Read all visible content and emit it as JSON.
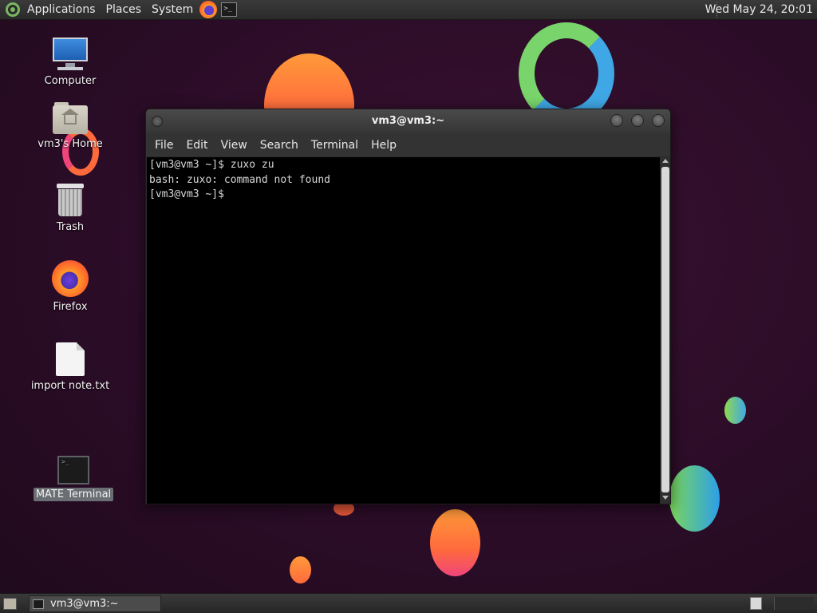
{
  "top_panel": {
    "menus": {
      "applications": "Applications",
      "places": "Places",
      "system": "System"
    },
    "launchers": [
      "firefox-icon",
      "terminal-icon"
    ],
    "clock": "Wed May 24, 20:01"
  },
  "desktop": {
    "icons": [
      {
        "label": "Computer",
        "icon": "computer-icon"
      },
      {
        "label": "vm3's Home",
        "icon": "home-folder-icon"
      },
      {
        "label": "Trash",
        "icon": "trash-icon"
      },
      {
        "label": "Firefox",
        "icon": "firefox-icon"
      },
      {
        "label": "import note.txt",
        "icon": "text-file-icon"
      },
      {
        "label": "MATE Terminal",
        "icon": "terminal-icon"
      }
    ]
  },
  "terminal": {
    "title": "vm3@vm3:~",
    "menus": [
      "File",
      "Edit",
      "View",
      "Search",
      "Terminal",
      "Help"
    ],
    "lines": [
      "[vm3@vm3 ~]$ zuxo zu",
      "bash: zuxo: command not found",
      "[vm3@vm3 ~]$ "
    ]
  },
  "bottom_panel": {
    "tasks": [
      {
        "label": "vm3@vm3:~",
        "icon": "terminal-icon"
      }
    ]
  },
  "colors": {
    "wallpaper": "#2b0c27",
    "panel": "#2f2f2f",
    "terminal_bg": "#000000",
    "terminal_fg": "#d8d8d8"
  }
}
